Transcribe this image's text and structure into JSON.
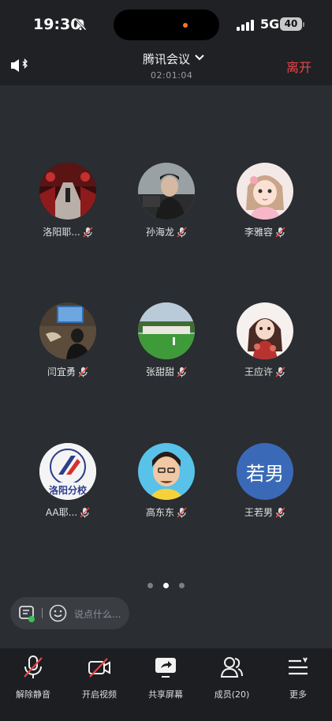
{
  "status_bar": {
    "time": "19:30",
    "network": "5G",
    "battery": "40"
  },
  "header": {
    "title": "腾讯会议",
    "elapsed": "02:01:04",
    "leave_label": "离开"
  },
  "participants": [
    {
      "name": "洛阳耶..."
    },
    {
      "name": "孙海龙"
    },
    {
      "name": "李雅容"
    },
    {
      "name": "闫宜勇"
    },
    {
      "name": "张甜甜"
    },
    {
      "name": "王应许"
    },
    {
      "name": "AA耶...",
      "avatar_text": "洛阳分校"
    },
    {
      "name": "高东东"
    },
    {
      "name": "王若男",
      "avatar_text": "若男"
    }
  ],
  "chat": {
    "placeholder": "说点什么..."
  },
  "toolbar": {
    "unmute": "解除静音",
    "start_video": "开启视频",
    "share_screen": "共享屏幕",
    "members": "成员(20)",
    "more": "更多"
  },
  "colors": {
    "accent_red": "#e8474a",
    "avatar_blue": "#3a6ab7"
  }
}
